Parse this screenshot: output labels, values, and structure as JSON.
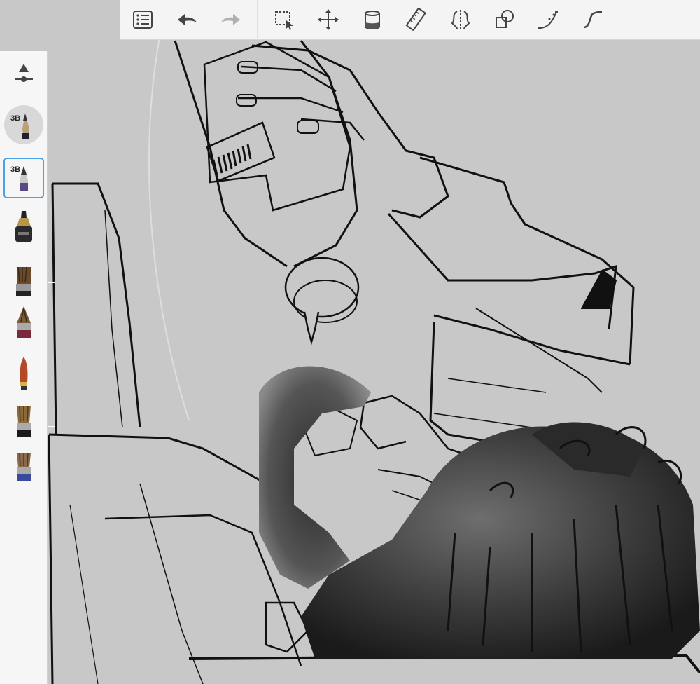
{
  "app": {
    "accent": "#4aa3e8",
    "toolbar_bg": "#f4f4f4",
    "canvas_bg": "#c8c8c8"
  },
  "toolbar": {
    "buttons": [
      {
        "name": "list-menu",
        "icon": "list-icon"
      },
      {
        "name": "undo",
        "icon": "undo-arrow-icon"
      },
      {
        "name": "redo",
        "icon": "redo-arrow-icon"
      },
      {
        "name": "selection",
        "icon": "selection-icon"
      },
      {
        "name": "transform",
        "icon": "move-arrows-icon"
      },
      {
        "name": "fill",
        "icon": "paint-bucket-icon"
      },
      {
        "name": "ruler",
        "icon": "ruler-icon"
      },
      {
        "name": "symmetry",
        "icon": "symmetry-icon"
      },
      {
        "name": "shapes",
        "icon": "shapes-icon"
      },
      {
        "name": "stroke-curve",
        "icon": "curve-dots-icon"
      },
      {
        "name": "predictive-stroke",
        "icon": "s-curve-icon"
      }
    ]
  },
  "sidebar": {
    "current_brush_label": "3B",
    "selected_brush_label": "3B",
    "brushes": [
      {
        "name": "pencil-3b",
        "icon": "pencil-icon"
      },
      {
        "name": "ink-pen",
        "icon": "ink-pen-icon"
      },
      {
        "name": "flat-brush",
        "icon": "flat-brush-icon"
      },
      {
        "name": "round-brush",
        "icon": "round-brush-icon"
      },
      {
        "name": "marker",
        "icon": "marker-icon"
      },
      {
        "name": "airbrush",
        "icon": "airbrush-icon"
      },
      {
        "name": "smudge-brush",
        "icon": "smudge-brush-icon"
      }
    ]
  }
}
